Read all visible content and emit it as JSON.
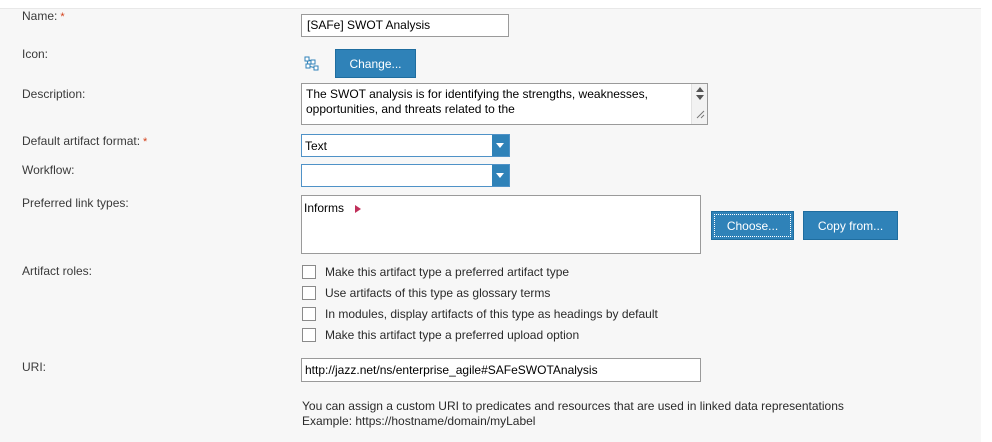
{
  "form": {
    "name": {
      "label": "Name:",
      "required_mark": "*",
      "value": "[SAFe] SWOT Analysis"
    },
    "icon": {
      "label": "Icon:",
      "change_button": "Change..."
    },
    "description": {
      "label": "Description:",
      "value": "The SWOT analysis is for identifying the strengths, weaknesses, opportunities, and threats related to the"
    },
    "default_format": {
      "label": "Default artifact format:",
      "required_mark": "*",
      "value": "Text"
    },
    "workflow": {
      "label": "Workflow:",
      "value": ""
    },
    "preferred_link_types": {
      "label": "Preferred link types:",
      "items": [
        "Informs"
      ],
      "choose_button": "Choose...",
      "copy_button": "Copy from..."
    },
    "artifact_roles": {
      "label": "Artifact roles:",
      "options": [
        {
          "label": "Make this artifact type a preferred artifact type",
          "checked": false
        },
        {
          "label": "Use artifacts of this type as glossary terms",
          "checked": false
        },
        {
          "label": "In modules, display artifacts of this type as headings by default",
          "checked": false
        },
        {
          "label": "Make this artifact type a preferred upload option",
          "checked": false
        }
      ]
    },
    "uri": {
      "label": "URI:",
      "value": "http://jazz.net/ns/enterprise_agile#SAFeSWOTAnalysis",
      "help_line1": "You can assign a custom URI to predicates and resources that are used in linked data representations",
      "help_line2": "Example: https://hostname/domain/myLabel"
    }
  },
  "colors": {
    "accent": "#2f82b8",
    "required": "#d4401a",
    "link_arrow": "#c0305a"
  },
  "icons": {
    "artifact_type_icon": "network-nodes-icon",
    "link_arrow": "triangle-right-icon"
  }
}
